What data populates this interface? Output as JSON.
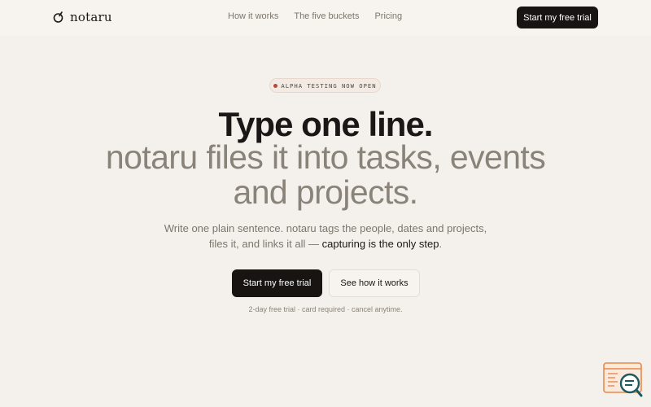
{
  "brand": {
    "name": "notaru",
    "logo_icon": "notaru-logo-icon"
  },
  "nav": {
    "items": [
      {
        "label": "How it works"
      },
      {
        "label": "The five buckets"
      },
      {
        "label": "Pricing"
      }
    ],
    "cta_label": "Start my free trial"
  },
  "hero": {
    "badge_text": "ALPHA TESTING NOW OPEN",
    "headline": "Type one line.",
    "subhead_line1": "notaru files it into tasks, events",
    "subhead_line2": "and projects.",
    "lead_line1": "Write one plain sentence. notaru tags the people, dates and projects,",
    "lead_line2_prefix": "files it, and links it all — ",
    "lead_line2_emphasis": "capturing is the only step",
    "lead_line2_suffix": ".",
    "primary_cta": "Start my free trial",
    "secondary_cta": "See how it works",
    "fine_print": "2-day free trial · card required · cancel anytime."
  },
  "widget": {
    "icon": "search-document-icon"
  },
  "colors": {
    "background": "#f4f1ec",
    "header_bg": "#f7f4ef",
    "ink": "#1a1816",
    "muted": "#8a837a",
    "button_dark": "#171412",
    "badge_dot": "#b44a3a",
    "widget_accent": "#e8894d",
    "widget_teal": "#1d5a60"
  }
}
